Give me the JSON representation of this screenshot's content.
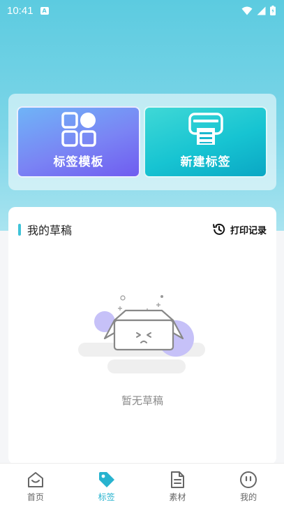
{
  "status_bar": {
    "time": "10:41",
    "notification_icon": "A"
  },
  "actions": {
    "template_label": "标签模板",
    "new_label": "新建标签"
  },
  "drafts": {
    "title": "我的草稿",
    "print_history": "打印记录",
    "empty_text": "暂无草稿"
  },
  "tabbar": {
    "items": [
      {
        "label": "首页",
        "icon": "home-icon",
        "active": false
      },
      {
        "label": "标签",
        "icon": "tag-icon",
        "active": true
      },
      {
        "label": "素材",
        "icon": "document-icon",
        "active": false
      },
      {
        "label": "我的",
        "icon": "profile-icon",
        "active": false
      }
    ]
  },
  "colors": {
    "accent": "#28b3cf",
    "template_gradient_end": "#6f5cf0",
    "new_gradient_end": "#0aa7c4"
  }
}
